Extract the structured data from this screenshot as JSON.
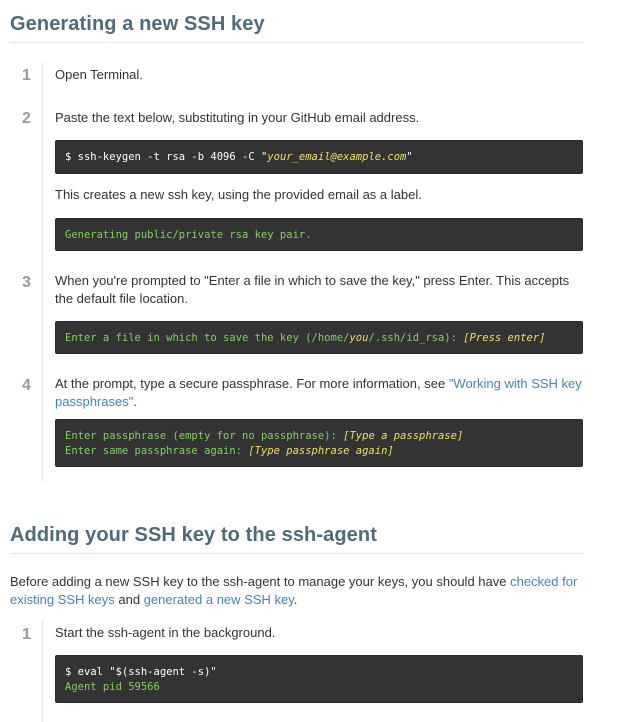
{
  "section1": {
    "title": "Generating a new SSH key",
    "steps": [
      {
        "number": "1",
        "text": "Open Terminal."
      },
      {
        "number": "2",
        "text": "Paste the text below, substituting in your GitHub email address.",
        "code_prefix": "$ ssh-keygen -t rsa -b 4096 -C \"",
        "code_email": "your_email@example.com",
        "code_suffix": "\"",
        "note": "This creates a new ssh key, using the provided email as a label.",
        "output": "Generating public/private rsa key pair."
      },
      {
        "number": "3",
        "text": "When you're prompted to \"Enter a file in which to save the key,\" press Enter. This accepts the default file location.",
        "code_a": "Enter a file in which to save the key (/home/",
        "code_you": "you",
        "code_b": "/.ssh/id_rsa): ",
        "code_press": "[Press enter]"
      },
      {
        "number": "4",
        "text_before": "At the prompt, type a secure passphrase. For more information, see ",
        "link": "\"Working with SSH key passphrases\"",
        "text_after": ".",
        "line1_a": "Enter passphrase (empty for no passphrase): ",
        "line1_b": "[Type a passphrase]",
        "line2_a": "Enter same passphrase again: ",
        "line2_b": "[Type passphrase again]"
      }
    ]
  },
  "section2": {
    "title": "Adding your SSH key to the ssh-agent",
    "intro_before": "Before adding a new SSH key to the ssh-agent to manage your keys, you should have ",
    "link1": "checked for existing SSH keys",
    "intro_middle": " and ",
    "link2": "generated a new SSH key",
    "intro_after": ".",
    "steps": [
      {
        "number": "1",
        "text": "Start the ssh-agent in the background.",
        "command": "$ eval \"$(ssh-agent -s)\"",
        "output": "Agent pid 59566"
      }
    ]
  }
}
